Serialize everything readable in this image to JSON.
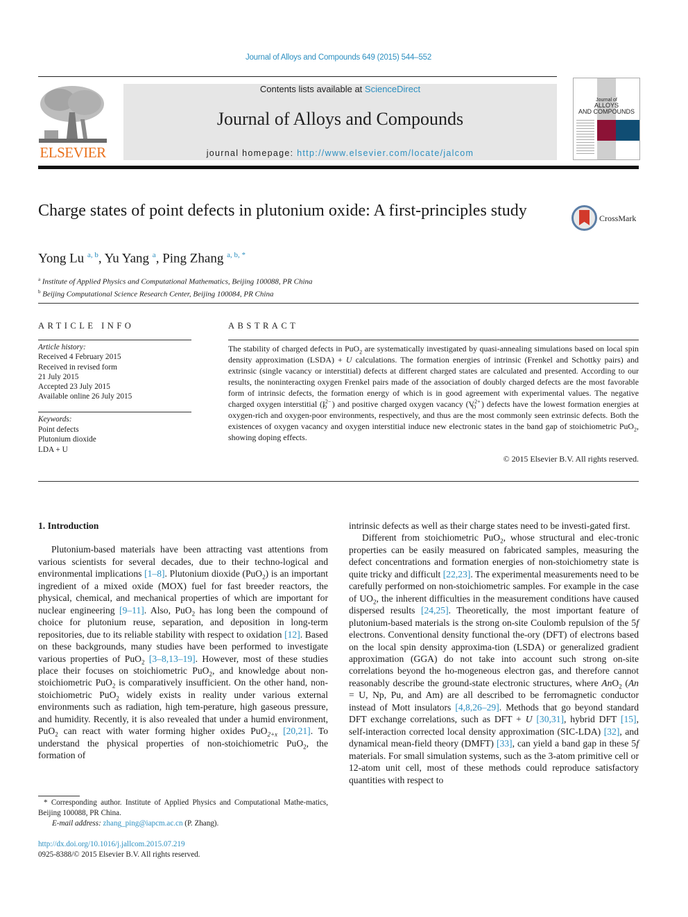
{
  "header": {
    "journal_reference": "Journal of Alloys and Compounds 649 (2015) 544–552",
    "contents_prefix": "Contents lists available at ",
    "contents_link": "ScienceDirect",
    "journal_title": "Journal of Alloys and Compounds",
    "homepage_prefix": "journal homepage: ",
    "homepage_url": "http://www.elsevier.com/locate/jalcom",
    "publisher_logo_text": "ELSEVIER",
    "cover": {
      "line1": "Journal of",
      "line2": "ALLOYS",
      "line3": "AND COMPOUNDS",
      "colors": {
        "red": "#8c1236",
        "blue": "#104d73"
      }
    }
  },
  "article": {
    "title": "Charge states of point defects in plutonium oxide: A first-principles study",
    "crossmark_label": "CrossMark",
    "authors": [
      {
        "name": "Yong Lu",
        "affil": "a, b"
      },
      {
        "name": "Yu Yang",
        "affil": "a"
      },
      {
        "name": "Ping Zhang",
        "affil": "a, b, *"
      }
    ],
    "affiliations": [
      {
        "key": "a",
        "text": "Institute of Applied Physics and Computational Mathematics, Beijing 100088, PR China"
      },
      {
        "key": "b",
        "text": "Beijing Computational Science Research Center, Beijing 100084, PR China"
      }
    ]
  },
  "article_info": {
    "heading": "ARTICLE INFO",
    "history_label": "Article history:",
    "history": [
      "Received 4 February 2015",
      "Received in revised form",
      "21 July 2015",
      "Accepted 23 July 2015",
      "Available online 26 July 2015"
    ],
    "keywords_label": "Keywords:",
    "keywords": [
      "Point defects",
      "Plutonium dioxide",
      "LDA + U"
    ]
  },
  "abstract": {
    "heading": "ABSTRACT",
    "p1": "The stability of charged defects in PuO",
    "p2": " are systematically investigated by quasi-annealing simulations based on local spin density approximation (LSDA) + ",
    "p3": " calculations. The formation energies of intrinsic (Frenkel and Schottky pairs) and extrinsic (single vacancy or interstitial) defects at different charged states are calculated and presented. According to our results, the noninteracting oxygen Frenkel pairs made of the association of doubly charged defects are the most favorable form of intrinsic defects, the formation energy of which is in good agreement with experimental values. The negative charged oxygen interstitial (I",
    "p4": ") and positive charged oxygen vacancy (V",
    "p5": ") defects have the lowest formation energies at oxygen-rich and oxygen-poor environments, respectively, and thus are the most commonly seen extrinsic defects. Both the existences of oxygen vacancy and oxygen interstitial induce new electronic states in the band gap of stoichiometric PuO",
    "p6": ", showing doping effects.",
    "sub_2": "2",
    "sub_O": "O",
    "sup_minus": "2−",
    "sup_plus": "2+",
    "U": "U",
    "copyright": "© 2015 Elsevier B.V. All rights reserved."
  },
  "body": {
    "section_heading": "1.  Introduction",
    "left": {
      "t1": "Plutonium-based materials have been attracting vast attentions from various scientists for several decades, due to their techno-logical and environmental implications ",
      "r1": "[1–8]",
      "t2": ". Plutonium dioxide (PuO",
      "t3": ") is an important ingredient of a mixed oxide (MOX) fuel for fast breeder reactors, the physical, chemical, and mechanical properties of which are important for nuclear engineering ",
      "r2": "[9–11]",
      "t4": ". Also, PuO",
      "t5": " has long been the compound of choice for plutonium reuse, separation, and deposition in long-term repositories, due to its reliable stability with respect to oxidation ",
      "r3": "[12]",
      "t6": ". Based on these backgrounds, many studies have been performed to investigate various properties of PuO",
      "r4": "[3–8,13–19]",
      "t7": ". However, most of these studies place their focuses on stoichiometric PuO",
      "t8": ", and knowledge about non-stoichiometric PuO",
      "t9": " is comparatively insufficient. On the other hand, non-stoichiometric PuO",
      "t10": " widely exists in reality under various external environments such as radiation, high tem-perature, high gaseous pressure, and humidity. Recently, it is also revealed that under a humid environment, PuO",
      "t11": " can react with water forming higher oxides PuO",
      "sub_2x": "2+x",
      "r5": "[20,21]",
      "t12": ". To understand the physical properties of non-stoichiometric PuO",
      "t13": ", the formation of"
    },
    "right": {
      "t1": "intrinsic defects as well as their charge states need to be investi-gated first.",
      "t2": "Different from stoichiometric PuO",
      "t3": ", whose structural and elec-tronic properties can be easily measured on fabricated samples, measuring the defect concentrations and formation energies of non-stoichiometry state is quite tricky and difficult ",
      "r1": "[22,23]",
      "t4": ". The experimental measurements need to be carefully performed on non-stoichiometric samples. For example in the case of UO",
      "t5": ", the inherent difficulties in the measurement conditions have caused dispersed results ",
      "r2": "[24,25]",
      "t6": ". Theoretically, the most important feature of plutonium-based materials is the strong on-site Coulomb repulsion of the 5",
      "f": "f",
      "t7": " electrons. Conventional density functional the-ory (DFT) of electrons based on the local spin density approxima-tion (LSDA) or generalized gradient approximation (GGA) do not take into account such strong on-site correlations beyond the ho-mogeneous electron gas, and therefore cannot reasonably describe the ground-state electronic structures, where ",
      "An": "An",
      "t8": "O",
      "t9": " (",
      "t10": " = U, Np, Pu, and Am) are all described to be ferromagnetic conductor instead of Mott insulators ",
      "r3": "[4,8,26–29]",
      "t11": ". Methods that go beyond standard DFT exchange correlations, such as DFT + ",
      "U": "U",
      "r4": "[30,31]",
      "t12": ", hybrid DFT ",
      "r5": "[15]",
      "t13": ", self-interaction corrected local density approximation (SIC-LDA) ",
      "r6": "[32]",
      "t14": ", and dynamical mean-field theory (DMFT) ",
      "r7": "[33]",
      "t15": ", can yield a band gap in these 5",
      "t16": " materials. For small simulation systems, such as the 3-atom primitive cell or 12-atom unit cell, most of these methods could reproduce satisfactory quantities with respect to"
    }
  },
  "footnotes": {
    "corresponding": "* Corresponding author. Institute of Applied Physics and Computational Mathe-matics, Beijing 100088, PR China.",
    "email_label": "E-mail address: ",
    "email": "zhang_ping@iapcm.ac.cn",
    "email_suffix": " (P. Zhang).",
    "doi": "http://dx.doi.org/10.1016/j.jallcom.2015.07.219",
    "issn": "0925-8388/© 2015 Elsevier B.V. All rights reserved."
  }
}
